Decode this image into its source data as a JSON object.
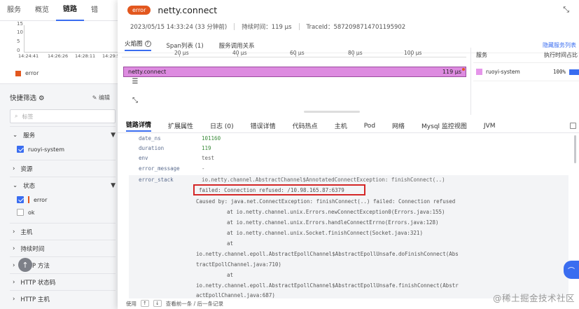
{
  "background": {
    "tabs": [
      "服务",
      "概览",
      "链路",
      "错"
    ],
    "chart": {
      "y_ticks": [
        "15",
        "10",
        "5",
        "0"
      ],
      "x_ticks": [
        "14:24:41",
        "14:26:26",
        "14:28:11",
        "14:29:5"
      ],
      "legend": "error"
    },
    "quick_filter": {
      "title": "快捷筛选",
      "edit": "编辑",
      "search_placeholder": "标签",
      "groups": {
        "service": "服务",
        "service_option": "ruoyi-system",
        "resource": "资源",
        "status": "状态",
        "status_error": "error",
        "status_ok": "ok",
        "host": "主机",
        "duration": "持续时间",
        "http_method": "HTTP 方法",
        "http_status": "HTTP 状态码",
        "http_host": "HTTP 主机"
      }
    }
  },
  "drawer": {
    "badge": "error",
    "title": "netty.connect",
    "meta": {
      "time": "2023/05/15 14:33:24 (33 分钟前)",
      "duration": "持续时间：119 µs",
      "trace_id": "TraceId：5872098714701195902"
    },
    "view_tabs": [
      "火焰图",
      "Span列表 (1)",
      "服务调用关系"
    ],
    "hide_service": "隐藏服务列表",
    "ruler": [
      "20 µs",
      "40 µs",
      "60 µs",
      "80 µs",
      "100 µs"
    ],
    "flame": {
      "name": "netty.connect",
      "duration": "119 µs"
    },
    "service_panel": {
      "col_service": "服务",
      "col_ratio": "执行时间占比",
      "row_name": "ruoyi-system",
      "row_pct": "100%"
    },
    "detail_tabs": [
      "链路详情",
      "扩展属性",
      "日志 (0)",
      "错误详情",
      "代码热点",
      "主机",
      "Pod",
      "网络",
      "Mysql 监控视图",
      "JVM"
    ],
    "attributes": [
      {
        "key": "date_ns",
        "value": "101160"
      },
      {
        "key": "duration",
        "value": "119"
      },
      {
        "key": "env",
        "value": "test"
      },
      {
        "key": "error_message",
        "value": "-"
      },
      {
        "key": "error_stack",
        "value": "io.netty.channel.AbstractChannel$AnnotatedConnectException: finishConnect(..)"
      }
    ],
    "stack_lines": [
      "failed: Connection refused: /10.98.165.87:6379",
      "Caused by: java.net.ConnectException: finishConnect(..) failed: Connection refused",
      "at io.netty.channel.unix.Errors.newConnectException0(Errors.java:155)",
      "at io.netty.channel.unix.Errors.handleConnectErrno(Errors.java:128)",
      "at io.netty.channel.unix.Socket.finishConnect(Socket.java:321)",
      "at",
      "io.netty.channel.epoll.AbstractEpollChannel$AbstractEpollUnsafe.doFinishConnect(Abs",
      "tractEpollChannel.java:710)",
      "at",
      "io.netty.channel.epoll.AbstractEpollChannel$AbstractEpollUnsafe.finishConnect(Abstr",
      "actEpollChannel.java:687)"
    ],
    "footer": {
      "use": "使用",
      "up": "↑",
      "down": "↓",
      "hint": "查看前一条 / 后一条记录"
    }
  },
  "watermark": "@稀土掘金技术社区",
  "colors": {
    "error": "#e2571e",
    "accent": "#3a6df0",
    "flame": "#dd8be0",
    "highlight": "#d42727"
  }
}
